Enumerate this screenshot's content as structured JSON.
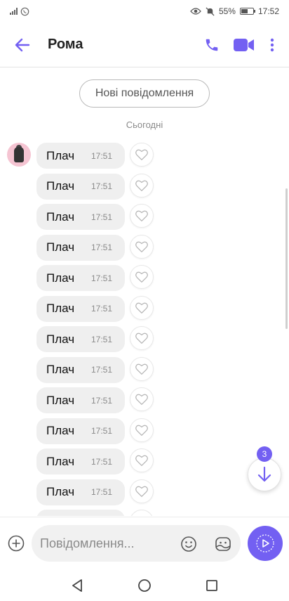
{
  "status_bar": {
    "battery": "55%",
    "battery_level": 0.55,
    "time": "17:52"
  },
  "header": {
    "contact_name": "Рома"
  },
  "chat": {
    "new_messages_label": "Нові повідомлення",
    "date_label": "Сьогодні",
    "messages": [
      {
        "text": "Плач",
        "time": "17:51"
      },
      {
        "text": "Плач",
        "time": "17:51"
      },
      {
        "text": "Плач",
        "time": "17:51"
      },
      {
        "text": "Плач",
        "time": "17:51"
      },
      {
        "text": "Плач",
        "time": "17:51"
      },
      {
        "text": "Плач",
        "time": "17:51"
      },
      {
        "text": "Плач",
        "time": "17:51"
      },
      {
        "text": "Плач",
        "time": "17:51"
      },
      {
        "text": "Плач",
        "time": "17:51"
      },
      {
        "text": "Плач",
        "time": "17:51"
      },
      {
        "text": "Плач",
        "time": "17:51"
      },
      {
        "text": "Плач",
        "time": "17:51"
      },
      {
        "text": "",
        "time": ""
      }
    ],
    "unread_count": "3"
  },
  "composer": {
    "placeholder": "Повідомлення..."
  },
  "colors": {
    "accent": "#7360f2",
    "bubble": "#efefef"
  },
  "icons": [
    "back-arrow-icon",
    "phone-icon",
    "video-icon",
    "more-vert-icon",
    "heart-icon",
    "arrow-down-icon",
    "plus-icon",
    "emoji-icon",
    "sticker-icon",
    "send-icon",
    "nav-back-icon",
    "nav-home-icon",
    "nav-recents-icon"
  ]
}
